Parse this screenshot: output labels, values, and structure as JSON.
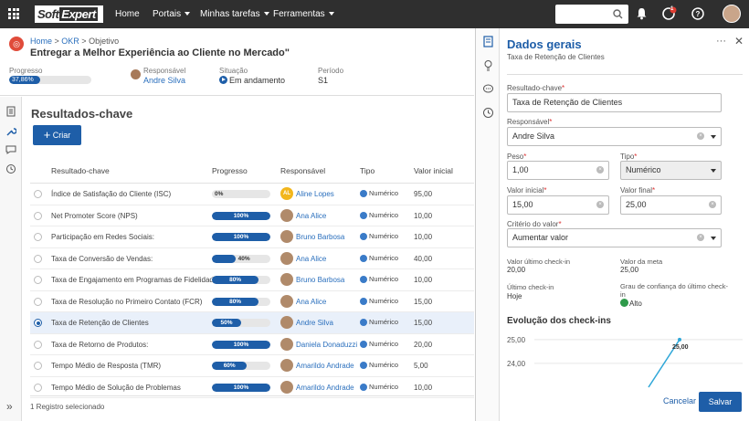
{
  "topbar": {
    "logo_a": "Soft",
    "logo_b": "Expert",
    "nav": [
      {
        "label": "Home",
        "dropdown": false
      },
      {
        "label": "Portais",
        "dropdown": true
      },
      {
        "label": "Minhas tarefas",
        "dropdown": true
      },
      {
        "label": "Ferramentas",
        "dropdown": true
      }
    ],
    "notification_badge": "1",
    "icons": [
      "apps-grid-icon",
      "search-icon",
      "bell-icon",
      "tasks-icon",
      "help-icon",
      "user-avatar"
    ]
  },
  "header": {
    "breadcrumb": [
      "Home",
      "OKR",
      "Objetivo"
    ],
    "title": "Entregar a Melhor Experiência ao Cliente no Mercado\"",
    "progress_label": "Progresso",
    "progress_value": "37,86%",
    "progress_fraction": 0.3786,
    "responsible_label": "Responsável",
    "responsible": "Andre Silva",
    "status_label": "Situação",
    "status": "Em andamento",
    "period_label": "Período",
    "period": "S1"
  },
  "main": {
    "title": "Resultados-chave",
    "create_label": "Criar",
    "columns": {
      "name": "Resultado-chave",
      "progress": "Progresso",
      "owner": "Responsável",
      "type": "Tipo",
      "initial": "Valor inicial"
    },
    "rows": [
      {
        "name": "Índice de Satisfação do Cliente (ISC)",
        "progress": "0%",
        "pct": 0,
        "owner": "Aline Lopes",
        "initials": "AL",
        "type": "Numérico",
        "initial": "95,00",
        "selected": false
      },
      {
        "name": "Net Promoter Score (NPS)",
        "progress": "100%",
        "pct": 100,
        "owner": "Ana Alice",
        "initials": "",
        "type": "Numérico",
        "initial": "10,00",
        "selected": false
      },
      {
        "name": "Participação em Redes Sociais:",
        "progress": "100%",
        "pct": 100,
        "owner": "Bruno Barbosa",
        "initials": "",
        "type": "Numérico",
        "initial": "10,00",
        "selected": false
      },
      {
        "name": "Taxa de Conversão de Vendas:",
        "progress": "40%",
        "pct": 40,
        "owner": "Ana Alice",
        "initials": "",
        "type": "Numérico",
        "initial": "40,00",
        "selected": false
      },
      {
        "name": "Taxa de Engajamento em Programas de Fidelidade:",
        "progress": "80%",
        "pct": 80,
        "owner": "Bruno Barbosa",
        "initials": "",
        "type": "Numérico",
        "initial": "10,00",
        "selected": false
      },
      {
        "name": "Taxa de Resolução no Primeiro Contato (FCR)",
        "progress": "80%",
        "pct": 80,
        "owner": "Ana Alice",
        "initials": "",
        "type": "Numérico",
        "initial": "15,00",
        "selected": false
      },
      {
        "name": "Taxa de Retenção de Clientes",
        "progress": "50%",
        "pct": 50,
        "owner": "Andre Silva",
        "initials": "",
        "type": "Numérico",
        "initial": "15,00",
        "selected": true
      },
      {
        "name": "Taxa de Retorno de Produtos:",
        "progress": "100%",
        "pct": 100,
        "owner": "Daniela Donaduzzi",
        "initials": "",
        "type": "Numérico",
        "initial": "20,00",
        "selected": false
      },
      {
        "name": "Tempo Médio de Resposta (TMR)",
        "progress": "60%",
        "pct": 60,
        "owner": "Amarildo Andrade",
        "initials": "",
        "type": "Numérico",
        "initial": "5,00",
        "selected": false
      },
      {
        "name": "Tempo Médio de Solução de Problemas",
        "progress": "100%",
        "pct": 100,
        "owner": "Amarildo Andrade",
        "initials": "",
        "type": "Numérico",
        "initial": "10,00",
        "selected": false
      }
    ],
    "footer": "1 Registro selecionado"
  },
  "panel": {
    "title": "Dados gerais",
    "subtitle": "Taxa de Retenção de Clientes",
    "kr_label": "Resultado-chave",
    "kr_value": "Taxa de Retenção de Clientes",
    "owner_label": "Responsável",
    "owner_value": "Andre Silva",
    "weight_label": "Peso",
    "weight_value": "1,00",
    "type_label": "Tipo",
    "type_value": "Numérico",
    "initial_label": "Valor inicial",
    "initial_value": "15,00",
    "final_label": "Valor final",
    "final_value": "25,00",
    "criterion_label": "Critério do valor",
    "criterion_value": "Aumentar valor",
    "last_checkin_value_label": "Valor último check-in",
    "last_checkin_value": "20,00",
    "goal_value_label": "Valor da meta",
    "goal_value": "25,00",
    "last_checkin_label": "Último check-in",
    "last_checkin": "Hoje",
    "confidence_label": "Grau de confiança do último check-in",
    "confidence": "Alto",
    "evolution_title": "Evolução dos check-ins",
    "cancel_label": "Cancelar",
    "save_label": "Salvar"
  },
  "chart_data": {
    "type": "line",
    "y_ticks": [
      "25,00",
      "24,00"
    ],
    "y_tick_values": [
      25,
      24
    ],
    "point_label": "25,00",
    "series": [
      {
        "values": [
          23,
          25
        ]
      }
    ]
  },
  "colors": {
    "primary": "#1e5ea8",
    "topbar": "#2f2f2f",
    "link": "#2a6fbd",
    "chart_line": "#2fa7d8"
  }
}
